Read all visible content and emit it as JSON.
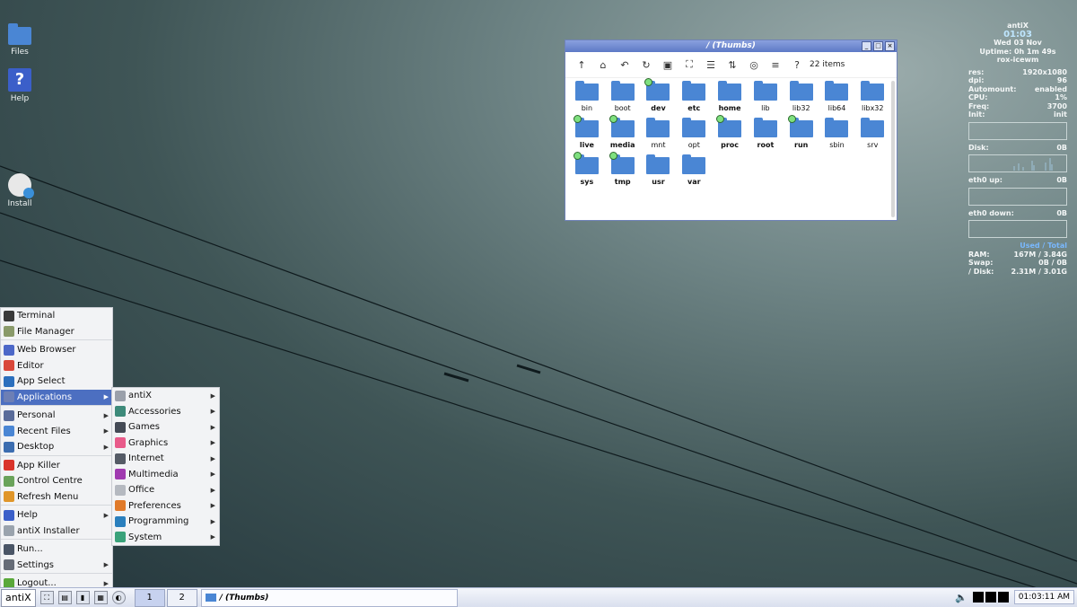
{
  "desktop": {
    "icons": [
      {
        "label": "Files"
      },
      {
        "label": "Help"
      },
      {
        "label": "Install"
      }
    ]
  },
  "window": {
    "title": "/ (Thumbs)",
    "item_count": "22 items",
    "files": [
      {
        "name": "bin",
        "bold": false,
        "mounted": false
      },
      {
        "name": "boot",
        "bold": false,
        "mounted": false
      },
      {
        "name": "dev",
        "bold": true,
        "mounted": true
      },
      {
        "name": "etc",
        "bold": true,
        "mounted": false
      },
      {
        "name": "home",
        "bold": true,
        "mounted": false
      },
      {
        "name": "lib",
        "bold": false,
        "mounted": false
      },
      {
        "name": "lib32",
        "bold": false,
        "mounted": false
      },
      {
        "name": "lib64",
        "bold": false,
        "mounted": false
      },
      {
        "name": "libx32",
        "bold": false,
        "mounted": false
      },
      {
        "name": "live",
        "bold": true,
        "mounted": true
      },
      {
        "name": "media",
        "bold": true,
        "mounted": true
      },
      {
        "name": "mnt",
        "bold": false,
        "mounted": false
      },
      {
        "name": "opt",
        "bold": false,
        "mounted": false
      },
      {
        "name": "proc",
        "bold": true,
        "mounted": true
      },
      {
        "name": "root",
        "bold": true,
        "mounted": false
      },
      {
        "name": "run",
        "bold": true,
        "mounted": true
      },
      {
        "name": "sbin",
        "bold": false,
        "mounted": false
      },
      {
        "name": "srv",
        "bold": false,
        "mounted": false
      },
      {
        "name": "sys",
        "bold": true,
        "mounted": true
      },
      {
        "name": "tmp",
        "bold": true,
        "mounted": true
      },
      {
        "name": "usr",
        "bold": true,
        "mounted": false
      },
      {
        "name": "var",
        "bold": true,
        "mounted": false
      }
    ]
  },
  "conky": {
    "host": "antiX",
    "time": "01:03",
    "date": "Wed 03 Nov",
    "uptime": "Uptime: 0h 1m 49s",
    "wm": "rox-icewm",
    "stats": [
      {
        "label": "res:",
        "value": "1920x1080"
      },
      {
        "label": "dpi:",
        "value": "96"
      },
      {
        "label": "Automount:",
        "value": "enabled"
      },
      {
        "label": "CPU:",
        "value": "1%"
      },
      {
        "label": "Freq:",
        "value": "3700"
      },
      {
        "label": "Init:",
        "value": "init"
      }
    ],
    "disk": {
      "label": "Disk:",
      "value": "0B"
    },
    "eth_up": {
      "label": "eth0 up:",
      "value": "0B"
    },
    "eth_down": {
      "label": "eth0 down:",
      "value": "0B"
    },
    "used_total": "Used / Total",
    "mem": [
      {
        "label": "RAM:",
        "value": "167M / 3.84G"
      },
      {
        "label": "Swap:",
        "value": "0B / 0B"
      },
      {
        "label": "/ Disk:",
        "value": "2.31M / 3.01G"
      }
    ]
  },
  "menu": {
    "items": [
      {
        "label": "Terminal",
        "icon": "terminal-icon",
        "color": "#3a3a3a",
        "arrow": false
      },
      {
        "label": "File Manager",
        "icon": "file-manager-icon",
        "color": "#8a9a6a",
        "arrow": false
      },
      {
        "sep": true
      },
      {
        "label": "Web Browser",
        "icon": "globe-icon",
        "color": "#4d68c8",
        "arrow": false
      },
      {
        "label": "Editor",
        "icon": "editor-icon",
        "color": "#d9483b",
        "arrow": false
      },
      {
        "label": "App Select",
        "icon": "search-icon",
        "color": "#2b6fbd",
        "arrow": false
      },
      {
        "label": "Applications",
        "icon": "apps-icon",
        "color": "#6d7fb5",
        "arrow": true,
        "selected": true
      },
      {
        "sep": true
      },
      {
        "label": "Personal",
        "icon": "personal-icon",
        "color": "#5a6c9a",
        "arrow": true
      },
      {
        "label": "Recent Files",
        "icon": "recent-files-icon",
        "color": "#4a86d4",
        "arrow": true
      },
      {
        "label": "Desktop",
        "icon": "desktop-icon",
        "color": "#3c6db0",
        "arrow": true
      },
      {
        "sep": true
      },
      {
        "label": "App Killer",
        "icon": "app-killer-icon",
        "color": "#d9342b",
        "arrow": false
      },
      {
        "label": "Control Centre",
        "icon": "control-centre-icon",
        "color": "#6aa35a",
        "arrow": false
      },
      {
        "label": "Refresh Menu",
        "icon": "refresh-icon",
        "color": "#e0962a",
        "arrow": false
      },
      {
        "sep": true
      },
      {
        "label": "Help",
        "icon": "help-icon",
        "color": "#3b5fc9",
        "arrow": true
      },
      {
        "label": "antiX Installer",
        "icon": "installer-icon",
        "color": "#9aa3ad",
        "arrow": false
      },
      {
        "sep": true
      },
      {
        "label": "Run...",
        "icon": "run-icon",
        "color": "#4a5566",
        "arrow": false
      },
      {
        "label": "Settings",
        "icon": "settings-icon",
        "color": "#666c77",
        "arrow": true
      },
      {
        "sep": true
      },
      {
        "label": "Logout...",
        "icon": "logout-icon",
        "color": "#5aa83a",
        "arrow": true
      }
    ]
  },
  "submenu": {
    "items": [
      {
        "label": "antiX",
        "icon": "antix-icon",
        "color": "#9aa0aa"
      },
      {
        "label": "Accessories",
        "icon": "accessories-icon",
        "color": "#3d8a7a"
      },
      {
        "label": "Games",
        "icon": "games-icon",
        "color": "#444a55"
      },
      {
        "label": "Graphics",
        "icon": "graphics-icon",
        "color": "#e85a8a"
      },
      {
        "label": "Internet",
        "icon": "internet-icon",
        "color": "#555b66"
      },
      {
        "label": "Multimedia",
        "icon": "multimedia-icon",
        "color": "#a03ab0"
      },
      {
        "label": "Office",
        "icon": "office-icon",
        "color": "#b5b9c0"
      },
      {
        "label": "Preferences",
        "icon": "preferences-icon",
        "color": "#e07a2a"
      },
      {
        "label": "Programming",
        "icon": "programming-icon",
        "color": "#2a7fbd"
      },
      {
        "label": "System",
        "icon": "system-icon",
        "color": "#3aa27a"
      }
    ]
  },
  "taskbar": {
    "start_label": "antiX",
    "workspaces": [
      "1",
      "2"
    ],
    "task_title": "/ (Thumbs)",
    "clock": "01:03:11 AM"
  }
}
